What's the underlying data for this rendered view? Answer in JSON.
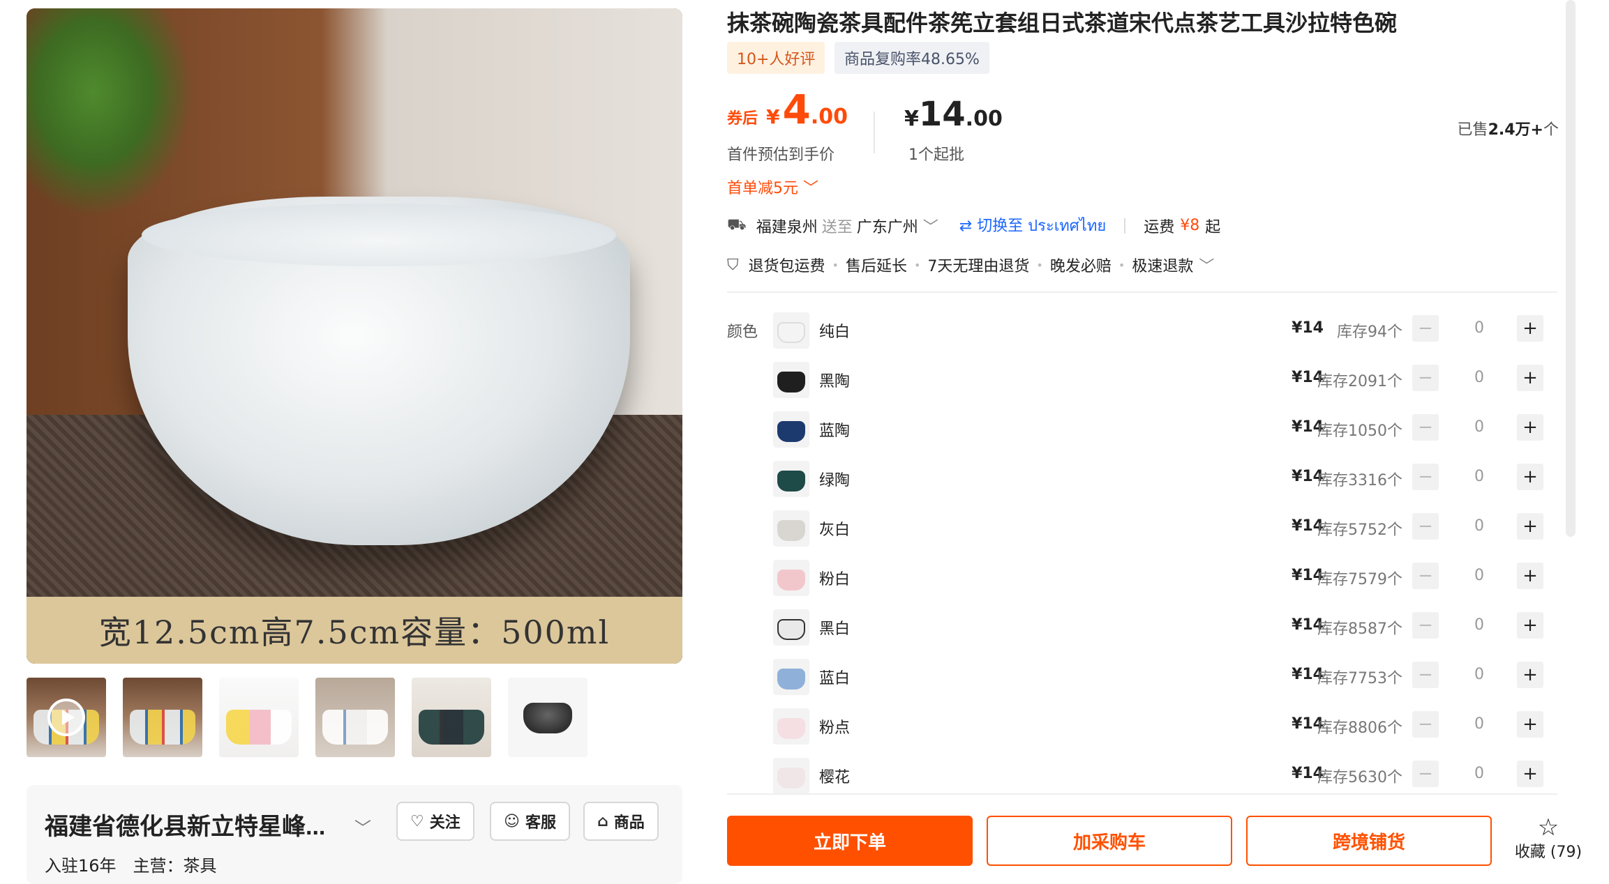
{
  "product": {
    "caption": "宽12.5cm高7.5cm容量：500ml",
    "title": "抹茶碗陶瓷茶具配件茶筅立套组日式茶道宋代点茶艺工具沙拉特色碗",
    "badges": {
      "reviews": "10+人好评",
      "repurchase": "商品复购率48.65%"
    }
  },
  "price": {
    "after_label": "券后",
    "currency": "¥",
    "after_int": "4",
    "after_dec": ".00",
    "after_note": "首件预估到手价",
    "discount": "首单减5元",
    "list_int": "14",
    "list_dec": ".00",
    "moq": "1个起批",
    "sold_prefix": "已售",
    "sold_value": "2.4万+",
    "sold_suffix": "个"
  },
  "shipping": {
    "from": "福建泉州",
    "to_label": "送至",
    "to": "广东广州",
    "switch": "切换至 ประเทศไทย",
    "fee_label": "运费",
    "fee": "¥8",
    "fee_suffix": "起"
  },
  "services": [
    "退货包运费",
    "售后延长",
    "7天无理由退货",
    "晚发必赔",
    "极速退款"
  ],
  "sku": {
    "label": "颜色",
    "items": [
      {
        "name": "纯白",
        "price": "¥14",
        "stock": "库存94个",
        "qty": "0",
        "color": "#f4f4f4"
      },
      {
        "name": "黑陶",
        "price": "¥14",
        "stock": "库存2091个",
        "qty": "0",
        "color": "#1f1f1f"
      },
      {
        "name": "蓝陶",
        "price": "¥14",
        "stock": "库存1050个",
        "qty": "0",
        "color": "#1d3a6e"
      },
      {
        "name": "绿陶",
        "price": "¥14",
        "stock": "库存3316个",
        "qty": "0",
        "color": "#1e4a48"
      },
      {
        "name": "灰白",
        "price": "¥14",
        "stock": "库存5752个",
        "qty": "0",
        "color": "#d9d6d2"
      },
      {
        "name": "粉白",
        "price": "¥14",
        "stock": "库存7579个",
        "qty": "0",
        "color": "#f2c7cc"
      },
      {
        "name": "黑白",
        "price": "¥14",
        "stock": "库存8587个",
        "qty": "0",
        "color": "#e9e9e9"
      },
      {
        "name": "蓝白",
        "price": "¥14",
        "stock": "库存7753个",
        "qty": "0",
        "color": "#8fb0d8"
      },
      {
        "name": "粉点",
        "price": "¥14",
        "stock": "库存8806个",
        "qty": "0",
        "color": "#f5dfe2"
      },
      {
        "name": "樱花",
        "price": "¥14",
        "stock": "库存5630个",
        "qty": "0",
        "color": "#f0e6e8"
      }
    ]
  },
  "actions": {
    "buy": "立即下单",
    "cart": "加采购车",
    "crossborder": "跨境铺货",
    "fav": "收藏 (79)"
  },
  "store": {
    "name": "福建省德化县新立特星峰...",
    "years": "入驻16年",
    "main": "主营：茶具",
    "follow": "关注",
    "service": "客服",
    "products": "商品"
  },
  "colors": {
    "accent": "#ff5000",
    "link": "#1a66ff"
  }
}
